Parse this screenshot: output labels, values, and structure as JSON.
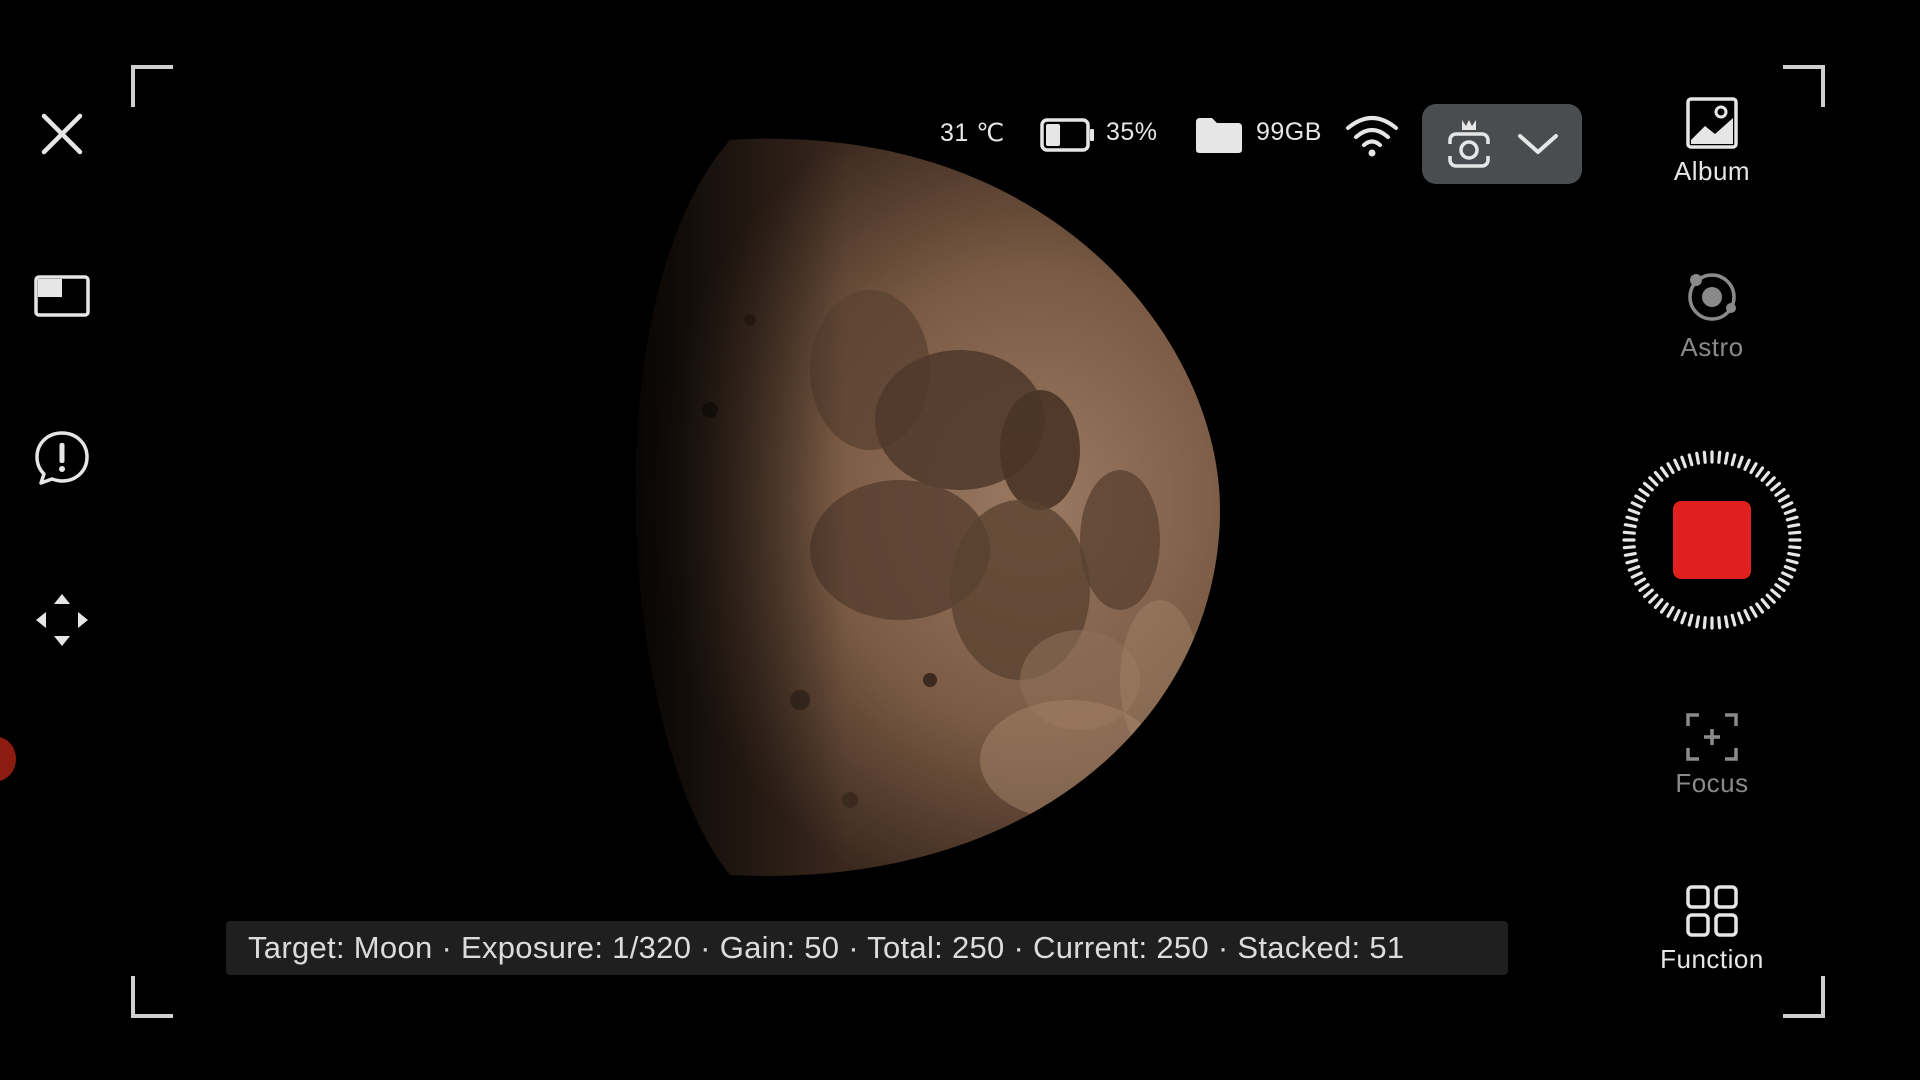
{
  "status": {
    "temperature": "31 ℃",
    "battery": "35%",
    "storage": "99GB"
  },
  "left_toolbar": {
    "close_icon": "close-icon",
    "layout_icon": "picture-in-picture-icon",
    "alert_icon": "alert-bubble-icon",
    "move_icon": "four-way-arrows-icon"
  },
  "right_panel": {
    "album_label": "Album",
    "astro_label": "Astro",
    "focus_label": "Focus",
    "function_label": "Function"
  },
  "capture": {
    "state": "recording",
    "stop_color": "#e0201e"
  },
  "info_bar": {
    "text": "Target: Moon · Exposure: 1/320 · Gain: 50 · Total: 250 · Current: 250 · Stacked: 51"
  },
  "colors": {
    "background": "#000000",
    "accent_red": "#e0201e",
    "panel": "#4a4d4f"
  }
}
